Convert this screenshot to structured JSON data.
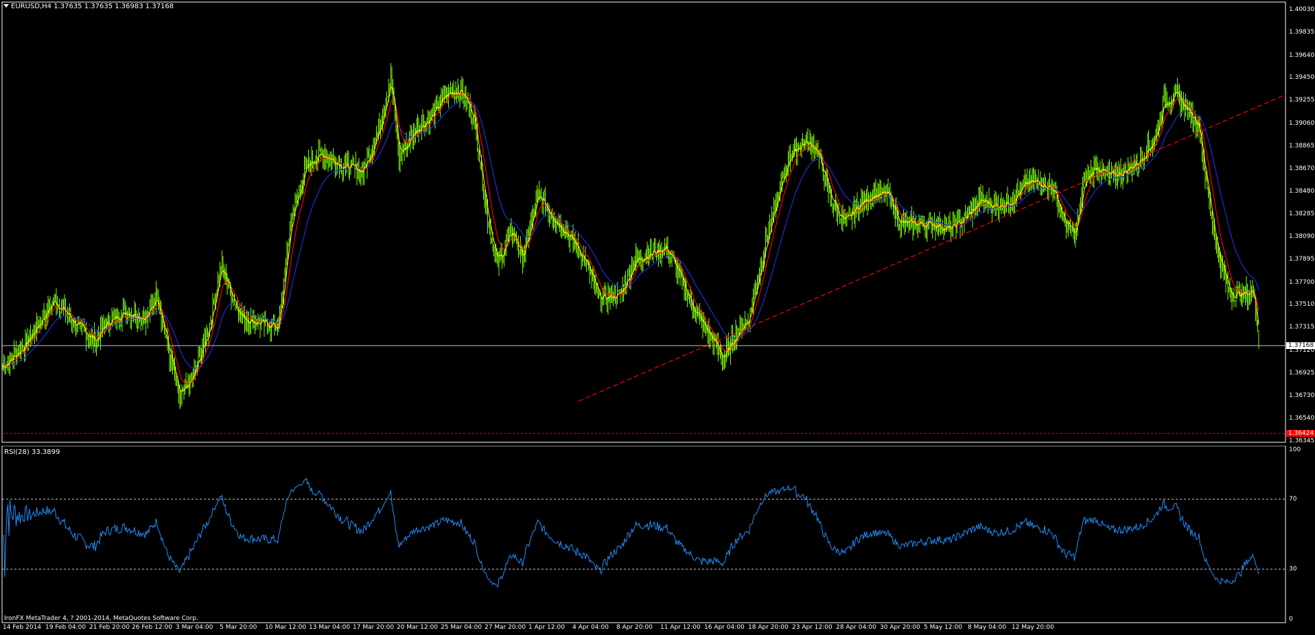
{
  "window": {
    "symbol_header": "EURUSD,H4  1.37635 1.37635 1.36983 1.37168",
    "menu_arrow_icon": "triangle-down-icon",
    "copyright": "IronFX MetaTrader 4, ? 2001-2014, MetaQuotes Software Corp."
  },
  "price_axis": {
    "ticks": [
      "1.40030",
      "1.39835",
      "1.39640",
      "1.39450",
      "1.39255",
      "1.39060",
      "1.38865",
      "1.38670",
      "1.38480",
      "1.38285",
      "1.38090",
      "1.37895",
      "1.37700",
      "1.37510",
      "1.37315",
      "1.37120",
      "1.36925",
      "1.36730",
      "1.36540",
      "1.36345"
    ],
    "current_price": "1.37168",
    "alert_price": "1.36424"
  },
  "rsi": {
    "label": "RSI(28) 33.3899",
    "levels": [
      "100",
      "70",
      "30",
      "0"
    ]
  },
  "time_axis": {
    "labels": [
      "14 Feb 2014",
      "19 Feb 04:00",
      "21 Feb 20:00",
      "26 Feb 12:00",
      "3 Mar 04:00",
      "5 Mar 20:00",
      "10 Mar 12:00",
      "13 Mar 04:00",
      "17 Mar 20:00",
      "20 Mar 12:00",
      "25 Mar 04:00",
      "27 Mar 20:00",
      "1 Apr 12:00",
      "4 Apr 04:00",
      "8 Apr 20:00",
      "11 Apr 12:00",
      "16 Apr 04:00",
      "18 Apr 20:00",
      "23 Apr 12:00",
      "28 Apr 04:00",
      "30 Apr 20:00",
      "5 May 12:00",
      "8 May 04:00",
      "12 May 20:00"
    ]
  },
  "colors": {
    "candles": "#7CFC00",
    "ma_fast": "#FFFF00",
    "ma_mid": "#FF0000",
    "ma_slow": "#1E2FD8",
    "trendline": "#FF0000",
    "rsi_line": "#1E90FF",
    "grid_border": "#FFFFFF",
    "alert_tag": "#FF0000"
  },
  "chart_data": {
    "type": "candlestick",
    "symbol": "EURUSD",
    "timeframe": "H4",
    "ylim": [
      1.36345,
      1.4003
    ],
    "keypoints": [
      [
        0,
        1.3698
      ],
      [
        20,
        1.3715
      ],
      [
        50,
        1.3755
      ],
      [
        70,
        1.3735
      ],
      [
        90,
        1.372
      ],
      [
        100,
        1.3735
      ],
      [
        120,
        1.3745
      ],
      [
        140,
        1.374
      ],
      [
        150,
        1.376
      ],
      [
        160,
        1.3715
      ],
      [
        172,
        1.367
      ],
      [
        185,
        1.369
      ],
      [
        200,
        1.373
      ],
      [
        212,
        1.3785
      ],
      [
        222,
        1.376
      ],
      [
        232,
        1.374
      ],
      [
        250,
        1.3735
      ],
      [
        268,
        1.3732
      ],
      [
        280,
        1.3825
      ],
      [
        295,
        1.387
      ],
      [
        310,
        1.388
      ],
      [
        330,
        1.387
      ],
      [
        350,
        1.3865
      ],
      [
        365,
        1.39
      ],
      [
        377,
        1.3945
      ],
      [
        385,
        1.3875
      ],
      [
        400,
        1.39
      ],
      [
        415,
        1.391
      ],
      [
        430,
        1.393
      ],
      [
        445,
        1.3935
      ],
      [
        458,
        1.391
      ],
      [
        470,
        1.383
      ],
      [
        480,
        1.3785
      ],
      [
        495,
        1.3815
      ],
      [
        505,
        1.379
      ],
      [
        520,
        1.3845
      ],
      [
        535,
        1.3825
      ],
      [
        550,
        1.381
      ],
      [
        565,
        1.379
      ],
      [
        580,
        1.3755
      ],
      [
        600,
        1.376
      ],
      [
        615,
        1.379
      ],
      [
        630,
        1.3795
      ],
      [
        645,
        1.38
      ],
      [
        660,
        1.377
      ],
      [
        672,
        1.3745
      ],
      [
        690,
        1.372
      ],
      [
        700,
        1.3705
      ],
      [
        712,
        1.3725
      ],
      [
        725,
        1.374
      ],
      [
        740,
        1.38
      ],
      [
        755,
        1.385
      ],
      [
        765,
        1.388
      ],
      [
        778,
        1.389
      ],
      [
        790,
        1.3885
      ],
      [
        805,
        1.384
      ],
      [
        818,
        1.382
      ],
      [
        830,
        1.3835
      ],
      [
        845,
        1.3845
      ],
      [
        860,
        1.3845
      ],
      [
        872,
        1.382
      ],
      [
        890,
        1.382
      ],
      [
        905,
        1.382
      ],
      [
        920,
        1.3815
      ],
      [
        935,
        1.3825
      ],
      [
        950,
        1.384
      ],
      [
        965,
        1.3835
      ],
      [
        980,
        1.384
      ],
      [
        995,
        1.3855
      ],
      [
        1010,
        1.3855
      ],
      [
        1020,
        1.385
      ],
      [
        1032,
        1.382
      ],
      [
        1042,
        1.381
      ],
      [
        1050,
        1.3855
      ],
      [
        1062,
        1.387
      ],
      [
        1075,
        1.386
      ],
      [
        1090,
        1.3865
      ],
      [
        1105,
        1.3875
      ],
      [
        1120,
        1.3895
      ],
      [
        1128,
        1.3925
      ],
      [
        1140,
        1.393
      ],
      [
        1152,
        1.3915
      ],
      [
        1162,
        1.3905
      ],
      [
        1168,
        1.386
      ],
      [
        1180,
        1.3795
      ],
      [
        1192,
        1.376
      ],
      [
        1205,
        1.376
      ],
      [
        1216,
        1.3762
      ],
      [
        1220,
        1.3717
      ]
    ]
  }
}
